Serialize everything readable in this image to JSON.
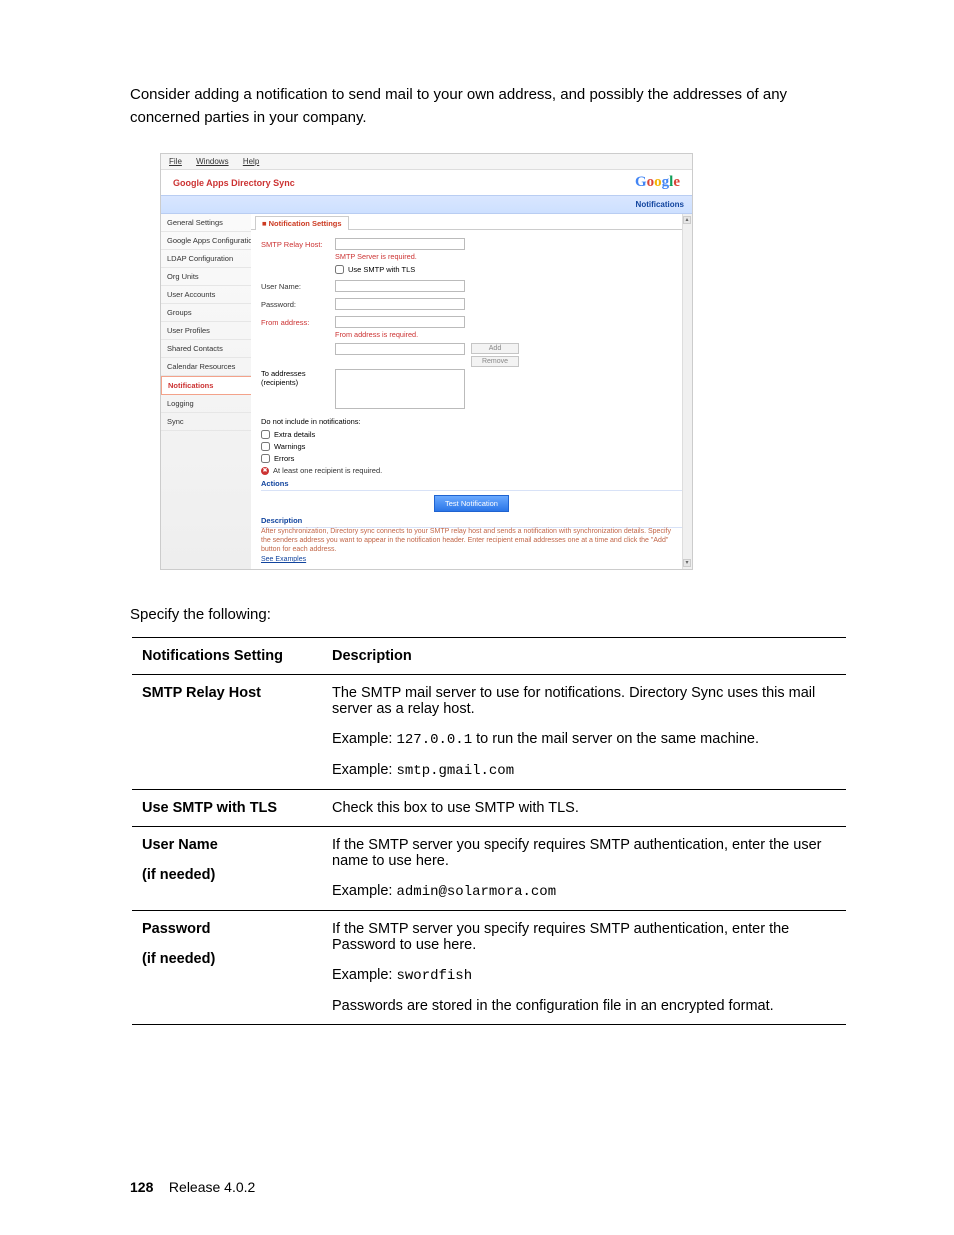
{
  "intro": "Consider adding a notification to send mail to your own address, and possibly the addresses of any concerned parties in your company.",
  "app": {
    "menus": {
      "file": "File",
      "windows": "Windows",
      "help": "Help"
    },
    "title": "Google Apps Directory Sync",
    "logo": {
      "g1": "G",
      "o1": "o",
      "o2": "o",
      "g2": "g",
      "l": "l",
      "e": "e"
    },
    "crumb": "Notifications",
    "sidebar": [
      "General Settings",
      "Google Apps Configuration",
      "LDAP Configuration",
      "Org Units",
      "User Accounts",
      "Groups",
      "User Profiles",
      "Shared Contacts",
      "Calendar Resources",
      "Notifications",
      "Logging",
      "Sync"
    ],
    "tab_label": "Notification Settings",
    "fields": {
      "relay_label": "SMTP Relay Host:",
      "relay_err": "SMTP Server is required.",
      "tls_label": "Use SMTP with TLS",
      "user_label": "User Name:",
      "pass_label": "Password:",
      "from_label": "From address:",
      "from_err": "From address is required.",
      "to_label": "To addresses (recipients)",
      "add": "Add",
      "remove": "Remove",
      "dni": "Do not include in notifications:",
      "opt1": "Extra details",
      "opt2": "Warnings",
      "opt3": "Errors",
      "req_msg": "At least one recipient is required.",
      "actions_hdr": "Actions",
      "test_btn": "Test Notification",
      "desc_hdr": "Description",
      "desc_body": "After synchronization, Directory sync connects to your SMTP relay host and sends a notification with synchronization details. Specify the senders address you want to appear in the notification header. Enter recipient email addresses one at a time and click the \"Add\" button for each address.",
      "see_ex": "See Examples"
    }
  },
  "spec_line": "Specify the following:",
  "table": {
    "h1": "Notifications Setting",
    "h2": "Description",
    "rows": [
      {
        "k": "SMTP Relay Host",
        "d1": "The SMTP mail server to use for notifications. Directory Sync uses this mail server as a relay host.",
        "d2a": "Example: ",
        "d2code": "127.0.0.1",
        "d2b": " to run the mail server on the same machine.",
        "d3a": "Example: ",
        "d3code": "smtp.gmail.com"
      },
      {
        "k": "Use SMTP with TLS",
        "d1": "Check this box to use SMTP with TLS."
      },
      {
        "k": "User Name",
        "ksub": "(if needed)",
        "d1": "If the SMTP server you specify requires SMTP authentication, enter the user name to use here.",
        "d2a": "Example: ",
        "d2code": "admin@solarmora.com"
      },
      {
        "k": "Password",
        "ksub": "(if needed)",
        "d1": "If the SMTP server you specify requires SMTP authentication, enter the Password to use here.",
        "d2a": "Example: ",
        "d2code": "swordfish",
        "d3": "Passwords are stored in the configuration file in an encrypted format."
      }
    ]
  },
  "footer": {
    "page": "128",
    "release": "Release 4.0.2"
  }
}
